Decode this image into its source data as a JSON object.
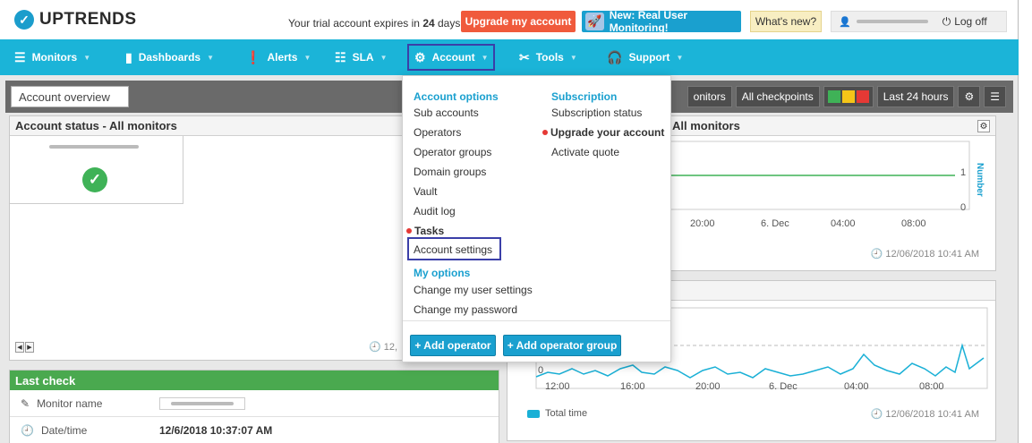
{
  "brand": {
    "name": "UPTRENDS"
  },
  "topbar": {
    "trial_prefix": "Your trial account expires in ",
    "trial_days": "24",
    "trial_suffix": " days.",
    "upgrade_label": "Upgrade my account",
    "rum_label": "New: Real User Monitoring!",
    "whats_new_label": "What's new?",
    "logoff_label": "Log off"
  },
  "nav": {
    "monitors": "Monitors",
    "dashboards": "Dashboards",
    "alerts": "Alerts",
    "sla": "SLA",
    "account": "Account",
    "tools": "Tools",
    "support": "Support"
  },
  "tabs": {
    "active": "Account overview"
  },
  "toolbar": {
    "monitors_partial": "onitors",
    "checkpoints": "All checkpoints",
    "range": "Last 24 hours",
    "status_colors": [
      "#3fb257",
      "#f5c518",
      "#e53935"
    ]
  },
  "account_status": {
    "title": "Account status - All monitors",
    "timestamp_partial": "12,"
  },
  "chart_top": {
    "title_partial": "All monitors",
    "ylabel": "Number",
    "yticks": [
      "1",
      "0"
    ],
    "xticks": [
      "20:00",
      "6. Dec",
      "04:00",
      "08:00"
    ],
    "timestamp": "12/06/2018 10:41 AM"
  },
  "chart_bottom": {
    "xticks": [
      "12:00",
      "16:00",
      "20:00",
      "6. Dec",
      "04:00",
      "08:00"
    ],
    "ytick": "0",
    "legend": "Total time",
    "timestamp": "12/06/2018 10:41 AM"
  },
  "last_check": {
    "title": "Last check",
    "monitor_name_label": "Monitor name",
    "datetime_label": "Date/time",
    "datetime_value": "12/6/2018 10:37:07 AM"
  },
  "account_menu": {
    "account_options_heading": "Account options",
    "account_options": [
      "Sub accounts",
      "Operators",
      "Operator groups",
      "Domain groups",
      "Vault",
      "Audit log",
      "Tasks",
      "Account settings"
    ],
    "my_options_heading": "My options",
    "my_options": [
      "Change my user settings",
      "Change my password"
    ],
    "subscription_heading": "Subscription",
    "subscription": [
      "Subscription status",
      "Upgrade your account",
      "Activate quote"
    ],
    "add_operator": "+ Add operator",
    "add_operator_group": "+ Add operator group"
  }
}
